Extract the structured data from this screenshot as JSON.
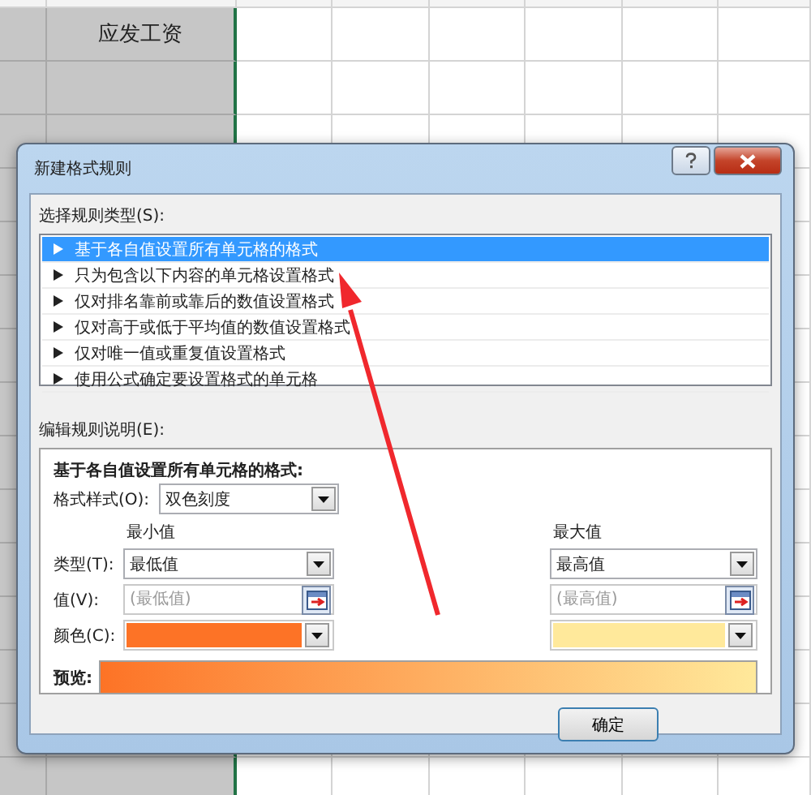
{
  "sheet": {
    "header_cell": "应发工资"
  },
  "dialog": {
    "title": "新建格式规则",
    "rule_type_label": "选择规则类型(S):",
    "rule_types": [
      {
        "label": "基于各自值设置所有单元格的格式",
        "selected": true
      },
      {
        "label": "只为包含以下内容的单元格设置格式",
        "selected": false
      },
      {
        "label": "仅对排名靠前或靠后的数值设置格式",
        "selected": false
      },
      {
        "label": "仅对高于或低于平均值的数值设置格式",
        "selected": false
      },
      {
        "label": "仅对唯一值或重复值设置格式",
        "selected": false
      },
      {
        "label": "使用公式确定要设置格式的单元格",
        "selected": false
      }
    ],
    "description_label": "编辑规则说明(E):",
    "description_heading": "基于各自值设置所有单元格的格式:",
    "format_style": {
      "label": "格式样式(O):",
      "value": "双色刻度"
    },
    "row_labels": {
      "type": "类型(T):",
      "value": "值(V):",
      "color_field": "颜色(C):"
    },
    "minimum": {
      "heading": "最小值",
      "type": "最低值",
      "value_placeholder": "(最低值)",
      "color": "#fd7326"
    },
    "maximum": {
      "heading": "最大值",
      "type": "最高值",
      "value_placeholder": "(最高值)",
      "color": "#ffe99b"
    },
    "preview_label": "预览:",
    "ok_button": "确定"
  }
}
